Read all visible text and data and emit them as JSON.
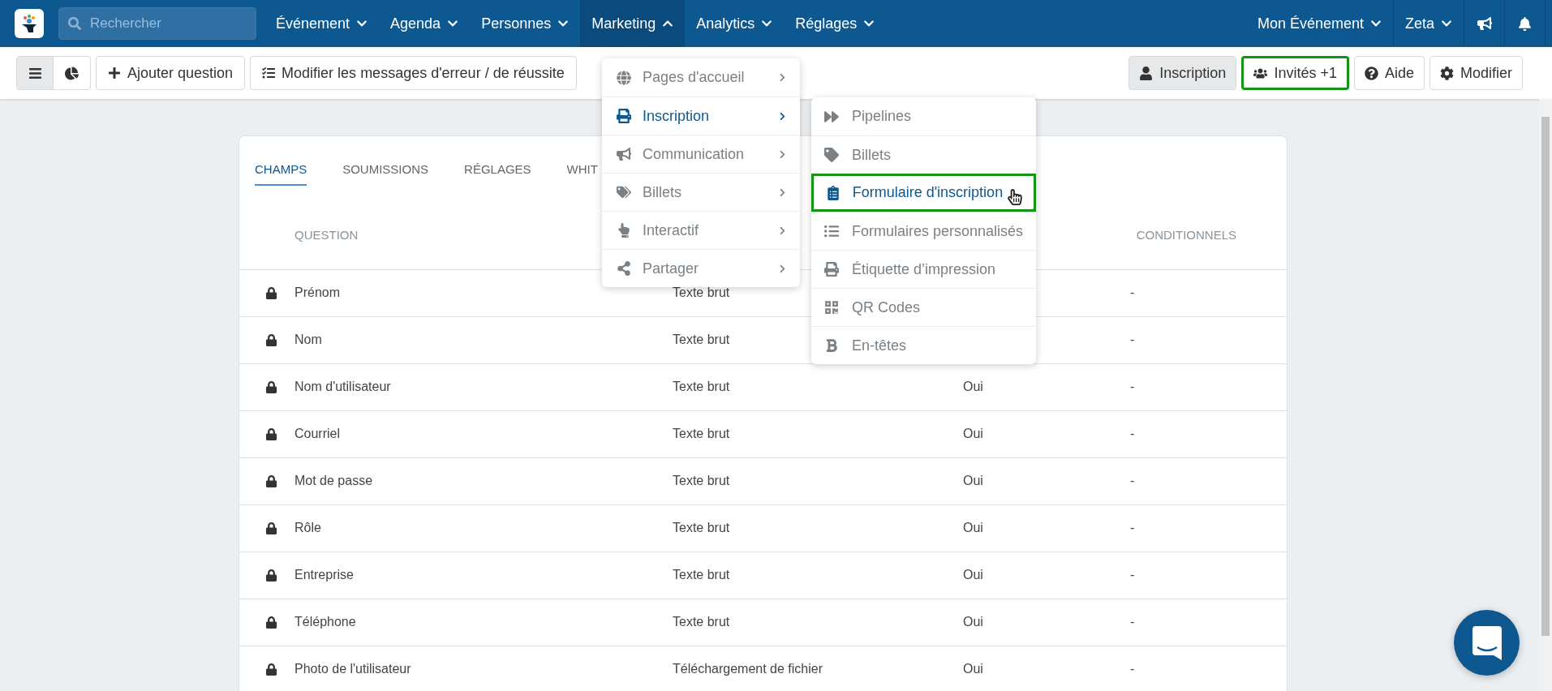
{
  "navbar": {
    "search": {
      "placeholder": "Rechercher"
    },
    "menus": [
      {
        "label": "Événement",
        "expanded": false
      },
      {
        "label": "Agenda",
        "expanded": false
      },
      {
        "label": "Personnes",
        "expanded": false
      },
      {
        "label": "Marketing",
        "expanded": true
      },
      {
        "label": "Analytics",
        "expanded": false
      },
      {
        "label": "Réglages",
        "expanded": false
      }
    ],
    "event_menu": "Mon Événement",
    "user_menu": "Zeta"
  },
  "toolbar": {
    "views": [
      {
        "kind": "list",
        "selected": true
      },
      {
        "kind": "chart",
        "selected": false
      }
    ],
    "actions": [
      {
        "kind": "add",
        "label": "Ajouter question"
      },
      {
        "kind": "messages",
        "label": "Modifier les messages d'erreur / de réussite"
      }
    ],
    "right_buttons": [
      {
        "kind": "user",
        "label": "Inscription",
        "selected": true,
        "highlighted": false
      },
      {
        "kind": "users",
        "label": "Invités +1",
        "selected": false,
        "highlighted": true
      },
      {
        "kind": "help",
        "label": "Aide",
        "selected": false,
        "highlighted": false
      },
      {
        "kind": "settings",
        "label": "Modifier",
        "selected": false,
        "highlighted": false
      }
    ]
  },
  "tabs": [
    {
      "label": "CHAMPS",
      "selected": true
    },
    {
      "label": "SOUMISSIONS",
      "selected": false
    },
    {
      "label": "RÉGLAGES",
      "selected": false
    },
    {
      "label": "WHIT",
      "selected": false
    }
  ],
  "table": {
    "headers": {
      "question": "QUESTION",
      "column_4": "CONDITIONNELS"
    },
    "rows": [
      {
        "locked": true,
        "question": "Prénom",
        "column_2": "Texte brut",
        "column_4": "-"
      },
      {
        "locked": true,
        "question": "Nom",
        "column_2": "Texte brut",
        "column_4": "-"
      },
      {
        "locked": true,
        "question": "Nom d'utilisateur",
        "column_2": "Texte brut",
        "column_3": "Oui",
        "column_4": "-"
      },
      {
        "locked": true,
        "question": "Courriel",
        "column_2": "Texte brut",
        "column_3": "Oui",
        "column_4": "-"
      },
      {
        "locked": true,
        "question": "Mot de passe",
        "column_2": "Texte brut",
        "column_3": "Oui",
        "column_4": "-"
      },
      {
        "locked": true,
        "question": "Rôle",
        "column_2": "Texte brut",
        "column_3": "Oui",
        "column_4": "-"
      },
      {
        "locked": true,
        "question": "Entreprise",
        "column_2": "Texte brut",
        "column_3": "Oui",
        "column_4": "-"
      },
      {
        "locked": true,
        "question": "Téléphone",
        "column_2": "Texte brut",
        "column_3": "Oui",
        "column_4": "-"
      },
      {
        "locked": true,
        "question": "Photo de l'utilisateur",
        "column_2": "Téléchargement de fichier",
        "column_3": "Oui",
        "column_4": "-"
      }
    ]
  },
  "marketing_menu": [
    {
      "kind": "globe",
      "label": "Pages d'accueil",
      "selected": false
    },
    {
      "kind": "print",
      "label": "Inscription",
      "selected": true
    },
    {
      "kind": "bullhorn",
      "label": "Communication",
      "selected": false
    },
    {
      "kind": "tags",
      "label": "Billets",
      "selected": false
    },
    {
      "kind": "hand",
      "label": "Interactif",
      "selected": false
    },
    {
      "kind": "share",
      "label": "Partager",
      "selected": false
    }
  ],
  "submenu": [
    {
      "kind": "forward",
      "label": "Pipelines",
      "selected": false,
      "highlighted": false
    },
    {
      "kind": "tag",
      "label": "Billets",
      "selected": false,
      "highlighted": false
    },
    {
      "kind": "clipboard",
      "label": "Formulaire d'inscription",
      "selected": true,
      "highlighted": true
    },
    {
      "kind": "list",
      "label": "Formulaires personnalisés",
      "selected": false,
      "highlighted": false
    },
    {
      "kind": "print",
      "label": "Étiquette d’impression",
      "selected": false,
      "highlighted": false
    },
    {
      "kind": "qrcode",
      "label": "QR Codes",
      "selected": false,
      "highlighted": false
    },
    {
      "kind": "bold",
      "label": "En-têtes",
      "selected": false,
      "highlighted": false
    }
  ]
}
